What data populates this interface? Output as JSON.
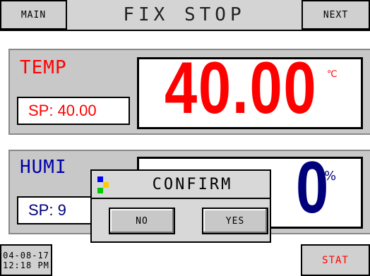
{
  "header": {
    "main_label": "MAIN",
    "title": "FIX STOP",
    "next_label": "NEXT"
  },
  "temp": {
    "label": "TEMP",
    "sp_text": "SP:  40.00",
    "value": "40.00",
    "unit": "℃"
  },
  "humi": {
    "label": "HUMI",
    "sp_text": "SP:  9",
    "value": "0",
    "unit": "%"
  },
  "dialog": {
    "title": "CONFIRM",
    "no_label": "NO",
    "yes_label": "YES"
  },
  "footer": {
    "date": "04-08-17",
    "time": "12:18 PM",
    "stat_label": "STAT"
  },
  "colors": {
    "temp": "#ff0000",
    "humi": "#00007a",
    "sp_text": "#ff0000",
    "humi_label": "#0000aa"
  }
}
